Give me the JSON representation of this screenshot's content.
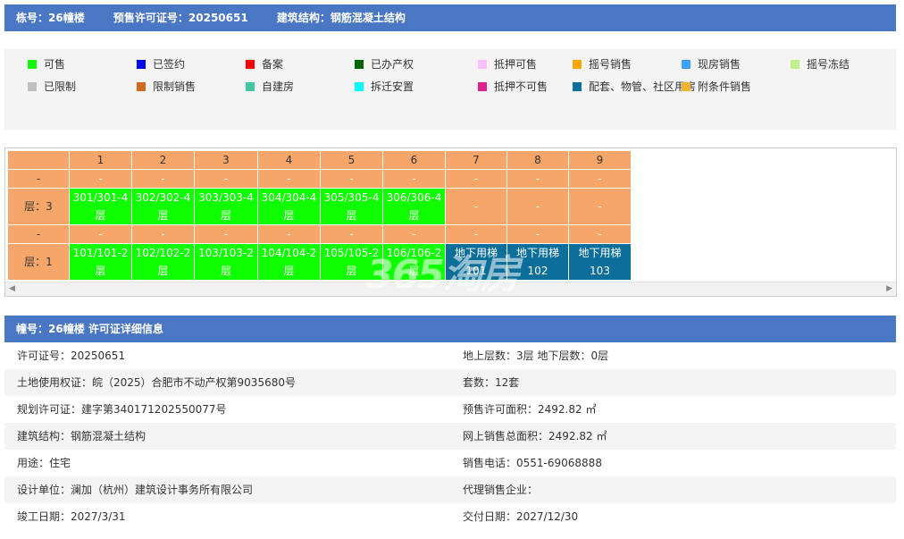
{
  "header": {
    "building": "栋号：26幢楼",
    "permit": "预售许可证号：20250651",
    "structure": "建筑结构：钢筋混凝土结构"
  },
  "legend": [
    {
      "label": "可售",
      "color": "#0fff00"
    },
    {
      "label": "已签约",
      "color": "#0000ff"
    },
    {
      "label": "备案",
      "color": "#ff0000"
    },
    {
      "label": "已办产权",
      "color": "#006400"
    },
    {
      "label": "抵押可售",
      "color": "#ffbfff"
    },
    {
      "label": "摇号销售",
      "color": "#ffa500"
    },
    {
      "label": "现房销售",
      "color": "#3f9fff"
    },
    {
      "label": "摇号冻结",
      "color": "#c0f08a"
    },
    {
      "label": "已限制",
      "color": "#bfbfbf"
    },
    {
      "label": "限制销售",
      "color": "#d2691e"
    },
    {
      "label": "自建房",
      "color": "#40c8a0"
    },
    {
      "label": "拆迁安置",
      "color": "#00ffff"
    },
    {
      "label": "抵押不可售",
      "color": "#e0208f"
    },
    {
      "label": "配套、物管、社区用房",
      "color": "#0c6e9a"
    },
    {
      "label": "附条件销售",
      "color": "#f0b430"
    }
  ],
  "units_table": {
    "columns": [
      "1",
      "2",
      "3",
      "4",
      "5",
      "6",
      "7",
      "8",
      "9"
    ],
    "dash": "-",
    "floor3_label": "层：3",
    "floor3": [
      "301/301-4层",
      "302/302-4层",
      "303/303-4层",
      "304/304-4层",
      "305/305-4层",
      "306/306-4层",
      "-",
      "-",
      "-"
    ],
    "floor1_label": "层：1",
    "floor1": [
      "101/101-2层",
      "102/102-2层",
      "103/103-2层",
      "104/104-2层",
      "105/105-2层",
      "106/106-2层",
      "地下用梯101",
      "地下用梯102",
      "地下用梯103"
    ]
  },
  "watermark": "365淘房",
  "info": {
    "title": "幢号：26幢楼 许可证详细信息",
    "rows": [
      {
        "left": "许可证号：20250651",
        "right": "地上层数：3层  地下层数：0层"
      },
      {
        "left": "土地使用权证：皖（2025）合肥市不动产权第9035680号",
        "right": "套数：12套"
      },
      {
        "left": "规划许可证：建字第340171202550077号",
        "right": "预售许可面积：2492.82 ㎡"
      },
      {
        "left": "建筑结构：钢筋混凝土结构",
        "right": "网上销售总面积：2492.82 ㎡"
      },
      {
        "left": "用途：住宅",
        "right": "销售电话：0551-69068888"
      },
      {
        "left": "设计单位：澜加（杭州）建筑设计事务所有限公司",
        "right": "代理销售企业："
      },
      {
        "left": "竣工日期：2027/3/31",
        "right": "交付日期：2027/12/30"
      }
    ]
  }
}
